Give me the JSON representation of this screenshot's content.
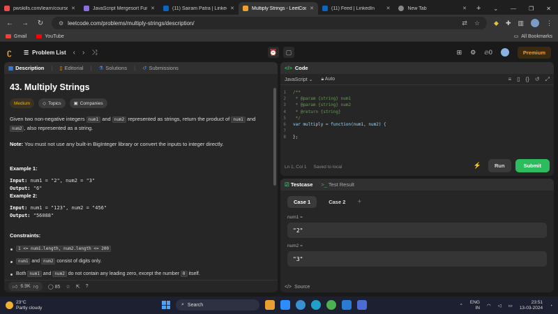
{
  "browser": {
    "tabs": [
      {
        "title": "pwskills.com/learn/course/",
        "color": "#e84c4c",
        "active": false
      },
      {
        "title": "JavaScript Mergesort Func",
        "color": "#8a6fe0",
        "active": false
      },
      {
        "title": "(11) Sairam Patra | LinkedIn",
        "color": "#0a66c2",
        "active": false
      },
      {
        "title": "Multiply Strings - LeetCode",
        "color": "#f0a030",
        "active": true
      },
      {
        "title": "(11) Feed | LinkedIn",
        "color": "#0a66c2",
        "active": false
      },
      {
        "title": "New Tab",
        "color": "#888888",
        "active": false
      }
    ],
    "url": "leetcode.com/problems/multiply-strings/description/",
    "bookmarks": [
      "Gmail",
      "YouTube"
    ],
    "all_bookmarks": "All Bookmarks"
  },
  "lc": {
    "problem_list": "Problem List",
    "premium": "Premium",
    "coins": "0"
  },
  "left": {
    "tabs": [
      "Description",
      "Editorial",
      "Solutions",
      "Submissions"
    ],
    "title": "43. Multiply Strings",
    "badges": [
      "Medium",
      "Topics",
      "Companies"
    ],
    "p1_a": "Given two non-negative integers ",
    "p1_num1": "num1",
    "p1_b": " and ",
    "p1_num2": "num2",
    "p1_c": " represented as strings, return the product of ",
    "p1_d": " and ",
    "p1_e": ", also represented as a string.",
    "note_label": "Note:",
    "note_text": " You must not use any built-in BigInteger library or convert the inputs to integer directly.",
    "ex1_title": "Example 1:",
    "ex1_input_label": "Input:",
    "ex1_input": " num1 = \"2\", num2 = \"3\"",
    "ex1_output_label": "Output:",
    "ex1_output": " \"6\"",
    "ex2_title": "Example 2:",
    "ex2_input_label": "Input:",
    "ex2_input": " num1 = \"123\", num2 = \"456\"",
    "ex2_output_label": "Output:",
    "ex2_output": " \"56088\"",
    "constraints_title": "Constraints:",
    "c1_code": "1 <= num1.length, num2.length <= 200",
    "c2_code1": "num1",
    "c2_and": " and ",
    "c2_code2": "num2",
    "c2_text": " consist of digits only.",
    "c3_a": "Both ",
    "c3_code1": "num1",
    "c3_and": " and ",
    "c3_code2": "num2",
    "c3_b": " do not contain any leading zero, except the number ",
    "c3_code3": "0",
    "c3_c": " itself.",
    "likes": "6.9K",
    "comments": "85"
  },
  "code": {
    "title": "Code",
    "language": "JavaScript",
    "mode": "Auto",
    "lines": [
      {
        "n": "1",
        "t": "/**"
      },
      {
        "n": "2",
        "t": " * @param {string} num1"
      },
      {
        "n": "3",
        "t": " * @param {string} num2"
      },
      {
        "n": "4",
        "t": " * @return {string}"
      },
      {
        "n": "5",
        "t": " */"
      },
      {
        "n": "6",
        "t": "var multiply = function(num1, num2) {"
      },
      {
        "n": "7",
        "t": ""
      },
      {
        "n": "8",
        "t": "};"
      }
    ],
    "cursor": "Ln 1, Col 1",
    "saved": "Saved to local",
    "run": "Run",
    "submit": "Submit"
  },
  "test": {
    "tabs": [
      "Testcase",
      "Test Result"
    ],
    "cases": [
      "Case 1",
      "Case 2"
    ],
    "var1_label": "num1 =",
    "var1_value": "\"2\"",
    "var2_label": "num2 =",
    "var2_value": "\"3\"",
    "source": "Source"
  },
  "taskbar": {
    "temp": "23°C",
    "weather": "Partly cloudy",
    "search": "Search",
    "lang": "ENG",
    "region": "IN",
    "time": "23:51",
    "date": "13-03-2024"
  }
}
